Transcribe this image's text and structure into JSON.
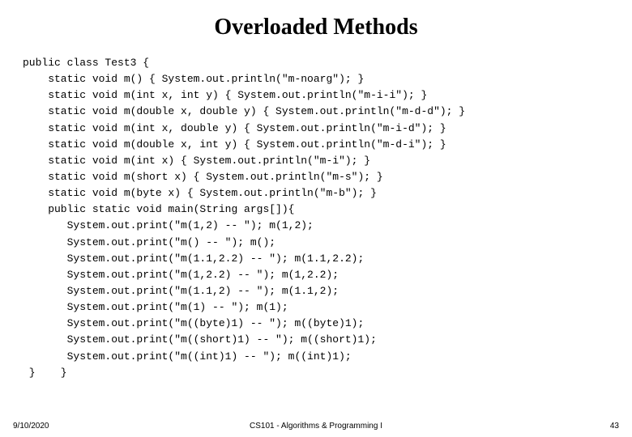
{
  "title": "Overloaded Methods",
  "code": {
    "l0": "public class Test3 {",
    "l1": "    static void m() { System.out.println(\"m-noarg\"); }",
    "l2": "    static void m(int x, int y) { System.out.println(\"m-i-i\"); }",
    "l3": "    static void m(double x, double y) { System.out.println(\"m-d-d\"); }",
    "l4": "    static void m(int x, double y) { System.out.println(\"m-i-d\"); }",
    "l5": "    static void m(double x, int y) { System.out.println(\"m-d-i\"); }",
    "l6": "    static void m(int x) { System.out.println(\"m-i\"); }",
    "l7": "    static void m(short x) { System.out.println(\"m-s\"); }",
    "l8": "    static void m(byte x) { System.out.println(\"m-b\"); }",
    "l9": "    public static void main(String args[]){",
    "l10": "       System.out.print(\"m(1,2) -- \"); m(1,2);",
    "l11": "       System.out.print(\"m() -- \"); m();",
    "l12": "       System.out.print(\"m(1.1,2.2) -- \"); m(1.1,2.2);",
    "l13": "       System.out.print(\"m(1,2.2) -- \"); m(1,2.2);",
    "l14": "       System.out.print(\"m(1.1,2) -- \"); m(1.1,2);",
    "l15": "       System.out.print(\"m(1) -- \"); m(1);",
    "l16": "       System.out.print(\"m((byte)1) -- \"); m((byte)1);",
    "l17": "       System.out.print(\"m((short)1) -- \"); m((short)1);",
    "l18": "       System.out.print(\"m((int)1) -- \"); m((int)1);",
    "l19": " }    }"
  },
  "footer": {
    "date": "9/10/2020",
    "center": "CS101 - Algorithms & Programming I",
    "page": "43"
  }
}
